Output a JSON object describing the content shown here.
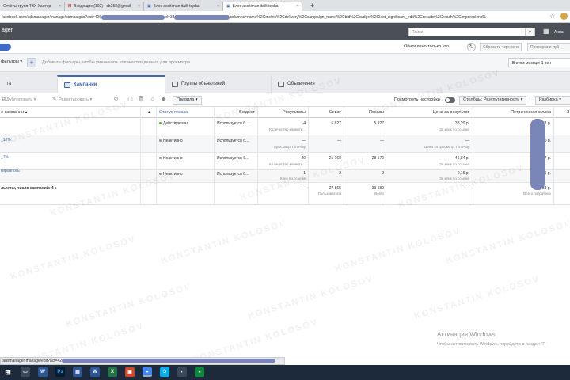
{
  "browser": {
    "tabs": [
      {
        "label": "Отчёты групп ТВХ Хантер"
      },
      {
        "label": "Входящие (102) - cb258@gmail"
      },
      {
        "label": "Блок ascitiman itailt tepha"
      },
      {
        "label": "Блок ascitiman itailt tepha – i"
      }
    ],
    "new_tab_label": "+",
    "url": "facebook.com/adsmanager/manage/campaigns?act=426",
    "url_tail": "columns=name%2Cmetric%2Cdelivery%2Ccampaign_name%2Cbid%2Cbudget%2Clast_significant_edit%2Cresults%2Creach%2Cimpressions%",
    "url_mid": "id=33"
  },
  "fb_header": {
    "brand": "ager",
    "search_placeholder": "Поиск",
    "user": "Анна"
  },
  "filter_bar": {
    "saved_status": "Обновлено только что",
    "reset_button": "Сбросить черновик",
    "review_button": "Проверка и пуб"
  },
  "filter_bar2": {
    "filters_label": "фильтры",
    "hint": "Добавьте фильтры, чтобы уменьшить количество данных для просмотра",
    "month_label": "В этом месяце: 1 сен"
  },
  "level_tabs": {
    "accounts": "та",
    "campaigns": "Кампании",
    "ad_sets": "Группы объявлений",
    "ads": "Объявления"
  },
  "toolbar": {
    "duplicate": "Дублировать",
    "edit": "Редактировать",
    "rules": "Правила",
    "view_settings": "Посмотреть настройки",
    "columns": "Столбцы: Результативность",
    "breakdown": "Разбивка"
  },
  "table": {
    "headers": {
      "name": "е кампании",
      "status": "Статус показа",
      "budget": "Бюджет",
      "results": "Результаты",
      "reach": "Охват",
      "impressions": "Показы",
      "cost": "Цена за результат",
      "spent": "Потраченная сумма",
      "extra": "З"
    },
    "rows": [
      {
        "name": "",
        "status": "Действующая",
        "status_color": "#42b72a",
        "budget": "Используется б...",
        "results": "4",
        "results_sub": "Количество клиенте...",
        "reach": "5 827",
        "impressions": "5 927",
        "cost": "38,20 р.",
        "cost_sub": "За клик по ссылке",
        "spent": "88 р."
      },
      {
        "name": "_10%",
        "status": "Неактивно",
        "status_color": "#90949c",
        "budget": "Используется б...",
        "results": "—",
        "results_sub": "Просмотр ThruPlay",
        "reach": "—",
        "impressions": "—",
        "cost": "—",
        "cost_sub": "Цена за просмотр ThruPlay",
        "spent": "0 р."
      },
      {
        "name": "_1%",
        "status": "Неактивно",
        "status_color": "#90949c",
        "budget": "Используется б...",
        "results": "20",
        "results_sub": "Количество клиенте...",
        "reach": "21 168",
        "impressions": "28 570",
        "cost": "46,84 р.",
        "cost_sub": "За клик по ссылке",
        "spent": "37 р."
      },
      {
        "name": "кировпось",
        "status": "Неактивно",
        "status_color": "#90949c",
        "budget": "Используется б...",
        "results": "1",
        "results_sub": "Клик по ссылке",
        "reach": "2",
        "impressions": "2",
        "cost": "0,16 р.",
        "cost_sub": "За клик по ссылке",
        "spent": "16 р."
      }
    ],
    "totals": {
      "label": "льтаты, число кампаний: 4",
      "results": "—",
      "reach": "27 865",
      "reach_sub": "Пользователи",
      "impressions": "33 589",
      "impressions_sub": "Всего",
      "cost": "—",
      "spent": "83 р.",
      "spent_sub": "Всего потрачено"
    }
  },
  "watermark": "KONSTANTIN KOLOSOV",
  "windows_activation": {
    "title": "Активация Windows",
    "subtitle": "Чтобы активировать Windows, перейдите в раздел \"П"
  },
  "status_url": "/adsmanager/manage/edit?act=42",
  "colors": {
    "fb_header": "#4b4f56",
    "accent": "#4267b2",
    "redaction": "#7b86b8",
    "taskbar": "#1c2a3b"
  }
}
